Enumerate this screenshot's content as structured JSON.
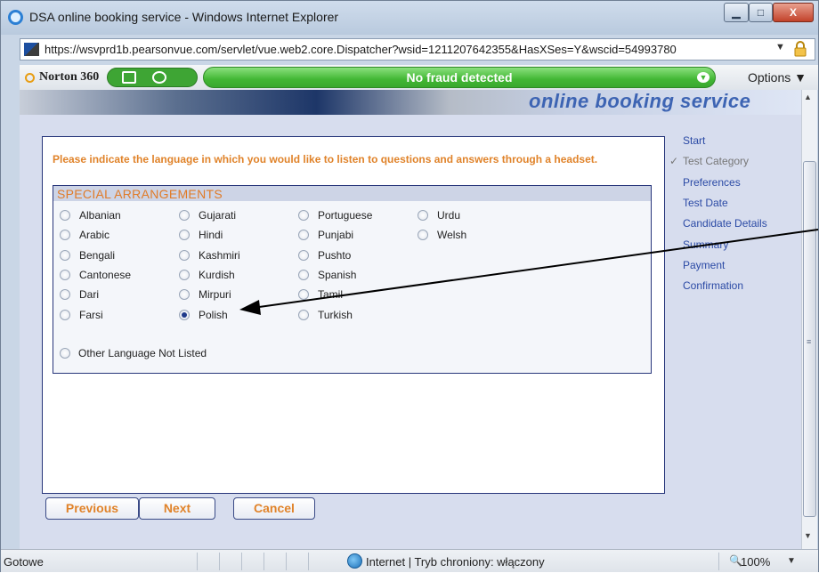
{
  "window": {
    "title": "DSA online booking service - Windows Internet Explorer",
    "min_glyph": "▁",
    "max_glyph": "□",
    "close_glyph": "X"
  },
  "address": {
    "url": "https://wsvprd1b.pearsonvue.com/servlet/vue.web2.core.Dispatcher?wsid=1211207642355&HasXSes=Y&wscid=54993780",
    "dropdown_glyph": "▼"
  },
  "norton": {
    "label": "Norton 360",
    "status": "No fraud detected",
    "options": "Options ▼",
    "status_color": "#42b734"
  },
  "banner": {
    "text": "online booking service"
  },
  "form": {
    "instruction": "Please indicate the language in which you would like to listen to questions and answers through a headset.",
    "section_title": "SPECIAL ARRANGEMENTS",
    "languages": [
      {
        "label": "Albanian",
        "checked": false
      },
      {
        "label": "Arabic",
        "checked": false
      },
      {
        "label": "Bengali",
        "checked": false
      },
      {
        "label": "Cantonese",
        "checked": false
      },
      {
        "label": "Dari",
        "checked": false
      },
      {
        "label": "Farsi",
        "checked": false
      },
      {
        "label": "Gujarati",
        "checked": false
      },
      {
        "label": "Hindi",
        "checked": false
      },
      {
        "label": "Kashmiri",
        "checked": false
      },
      {
        "label": "Kurdish",
        "checked": false
      },
      {
        "label": "Mirpuri",
        "checked": false
      },
      {
        "label": "Polish",
        "checked": true
      },
      {
        "label": "Portuguese",
        "checked": false
      },
      {
        "label": "Punjabi",
        "checked": false
      },
      {
        "label": "Pushto",
        "checked": false
      },
      {
        "label": "Spanish",
        "checked": false
      },
      {
        "label": "Tamil",
        "checked": false
      },
      {
        "label": "Turkish",
        "checked": false
      },
      {
        "label": "Urdu",
        "checked": false
      },
      {
        "label": "Welsh",
        "checked": false
      }
    ],
    "other_language": "Other Language Not Listed",
    "buttons": {
      "previous": "Previous",
      "next": "Next",
      "cancel": "Cancel"
    },
    "accent_color": "#e0832a"
  },
  "sidenav": {
    "items": [
      {
        "label": "Start",
        "done": false
      },
      {
        "label": "Test Category",
        "done": true
      },
      {
        "label": "Preferences",
        "done": false
      },
      {
        "label": "Test Date",
        "done": false
      },
      {
        "label": "Candidate Details",
        "done": false
      },
      {
        "label": "Summary",
        "done": false
      },
      {
        "label": "Payment",
        "done": false
      },
      {
        "label": "Confirmation",
        "done": false
      }
    ],
    "done_mark": "✓"
  },
  "status": {
    "text": "Gotowe",
    "zone": "Internet | Tryb chroniony: włączony",
    "zoom": "100%"
  }
}
